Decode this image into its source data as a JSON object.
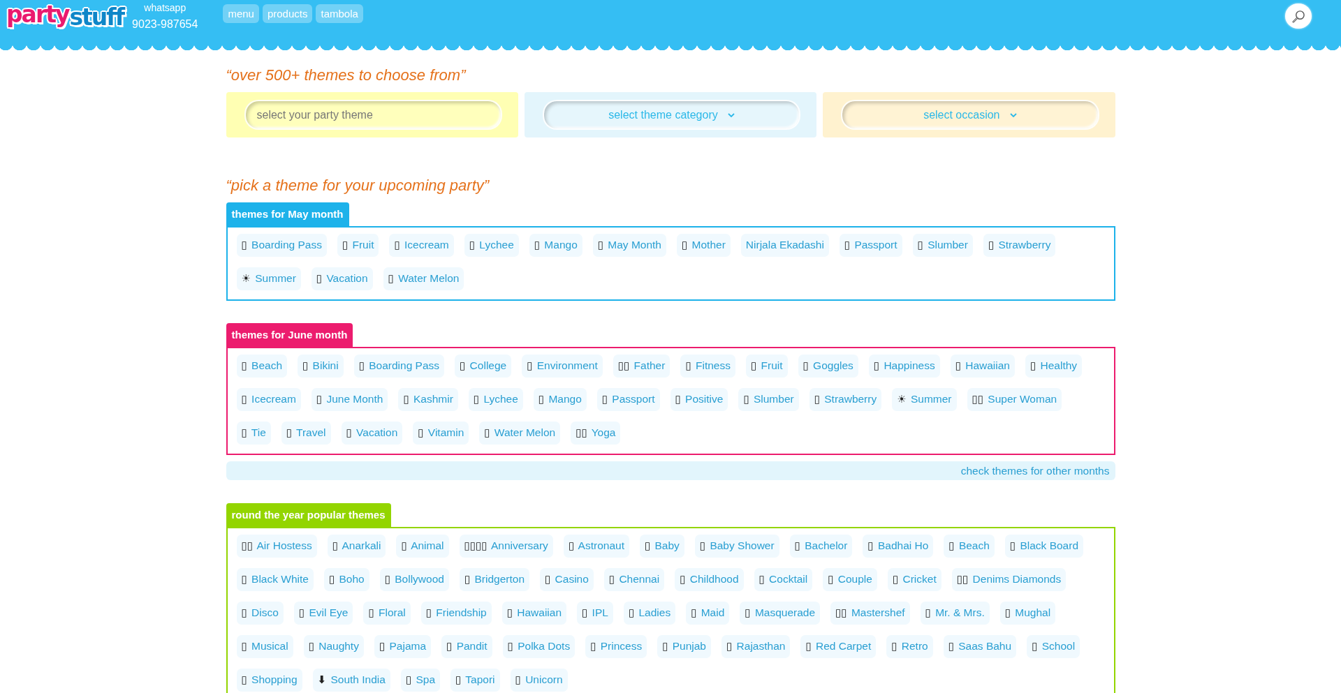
{
  "header": {
    "logo": [
      {
        "text": "party",
        "color": "#ea1a6f"
      },
      {
        "text": "stuff",
        "color": "#0e86c8"
      }
    ],
    "contact": {
      "label": "whatsapp",
      "phone": "9023-987654"
    },
    "nav": [
      "menu",
      "products",
      "tambola"
    ]
  },
  "search_heading": "“over 500+ themes to choose from”",
  "filters": [
    {
      "kind": "input",
      "placeholder": "select your party theme",
      "color": "#ffffb3"
    },
    {
      "kind": "select",
      "value": "select theme category",
      "color": "#e3f5fc"
    },
    {
      "kind": "select",
      "value": "select occasion",
      "color": "#fff2cf"
    }
  ],
  "pick_heading": "“pick a theme for your upcoming party”",
  "sections": [
    {
      "title": "themes for May month",
      "color": "#1db2ea",
      "tags": [
        {
          "icon": "▯",
          "label": "Boarding Pass"
        },
        {
          "icon": "▯",
          "label": "Fruit"
        },
        {
          "icon": "▯",
          "label": "Icecream"
        },
        {
          "icon": "▯",
          "label": "Lychee"
        },
        {
          "icon": "▯",
          "label": "Mango"
        },
        {
          "icon": "▯",
          "label": "May Month"
        },
        {
          "icon": "▯",
          "label": "Mother"
        },
        {
          "label": "Nirjala Ekadashi"
        },
        {
          "icon": "▯",
          "label": "Passport"
        },
        {
          "icon": "▯",
          "label": "Slumber"
        },
        {
          "icon": "▯",
          "label": "Strawberry"
        },
        {
          "icon": "☀",
          "label": "Summer"
        },
        {
          "icon": "▯",
          "label": "Vacation"
        },
        {
          "icon": "▯",
          "label": "Water Melon"
        }
      ]
    },
    {
      "title": "themes for June month",
      "color": "#ec1c6e",
      "footer_link": "check themes for other months",
      "tags": [
        {
          "icon": "▯",
          "label": "Beach"
        },
        {
          "icon": "▯",
          "label": "Bikini"
        },
        {
          "icon": "▯",
          "label": "Boarding Pass"
        },
        {
          "icon": "▯",
          "label": "College"
        },
        {
          "icon": "▯",
          "label": "Environment"
        },
        {
          "icon": "▯▯",
          "label": "Father"
        },
        {
          "icon": "▯",
          "label": "Fitness"
        },
        {
          "icon": "▯",
          "label": "Fruit"
        },
        {
          "icon": "▯",
          "label": "Goggles"
        },
        {
          "icon": "▯",
          "label": "Happiness"
        },
        {
          "icon": "▯",
          "label": "Hawaiian"
        },
        {
          "icon": "▯",
          "label": "Healthy"
        },
        {
          "icon": "▯",
          "label": "Icecream"
        },
        {
          "icon": "▯",
          "label": "June Month"
        },
        {
          "icon": "▯",
          "label": "Kashmir"
        },
        {
          "icon": "▯",
          "label": "Lychee"
        },
        {
          "icon": "▯",
          "label": "Mango"
        },
        {
          "icon": "▯",
          "label": "Passport"
        },
        {
          "icon": "▯",
          "label": "Positive"
        },
        {
          "icon": "▯",
          "label": "Slumber"
        },
        {
          "icon": "▯",
          "label": "Strawberry"
        },
        {
          "icon": "☀",
          "label": "Summer"
        },
        {
          "icon": "▯▯",
          "label": "Super Woman"
        },
        {
          "icon": "▯",
          "label": "Tie"
        },
        {
          "icon": "▯",
          "label": "Travel"
        },
        {
          "icon": "▯",
          "label": "Vacation"
        },
        {
          "icon": "▯",
          "label": "Vitamin"
        },
        {
          "icon": "▯",
          "label": "Water Melon"
        },
        {
          "icon": "▯▯",
          "label": "Yoga"
        }
      ]
    },
    {
      "title": "round the year popular themes",
      "color": "#93d500",
      "tags": [
        {
          "icon": "▯▯",
          "label": "Air Hostess"
        },
        {
          "icon": "▯",
          "label": "Anarkali"
        },
        {
          "icon": "▯",
          "label": "Animal"
        },
        {
          "icon": "▯▯▯▯",
          "label": "Anniversary"
        },
        {
          "icon": "▯",
          "label": "Astronaut"
        },
        {
          "icon": "▯",
          "label": "Baby"
        },
        {
          "icon": "▯",
          "label": "Baby Shower"
        },
        {
          "icon": "▯",
          "label": "Bachelor"
        },
        {
          "icon": "▯",
          "label": "Badhai Ho"
        },
        {
          "icon": "▯",
          "label": "Beach"
        },
        {
          "icon": "▯",
          "label": "Black Board"
        },
        {
          "icon": "▯",
          "label": "Black White"
        },
        {
          "icon": "▯",
          "label": "Boho"
        },
        {
          "icon": "▯",
          "label": "Bollywood"
        },
        {
          "icon": "▯",
          "label": "Bridgerton"
        },
        {
          "icon": "▯",
          "label": "Casino"
        },
        {
          "icon": "▯",
          "label": "Chennai"
        },
        {
          "icon": "▯",
          "label": "Childhood"
        },
        {
          "icon": "▯",
          "label": "Cocktail"
        },
        {
          "icon": "▯",
          "label": "Couple"
        },
        {
          "icon": "▯",
          "label": "Cricket"
        },
        {
          "icon": "▯▯",
          "label": "Denims Diamonds"
        },
        {
          "icon": "▯",
          "label": "Disco"
        },
        {
          "icon": "▯",
          "label": "Evil Eye"
        },
        {
          "icon": "▯",
          "label": "Floral"
        },
        {
          "icon": "▯",
          "label": "Friendship"
        },
        {
          "icon": "▯",
          "label": "Hawaiian"
        },
        {
          "icon": "▯",
          "label": "IPL"
        },
        {
          "icon": "▯",
          "label": "Ladies"
        },
        {
          "icon": "▯",
          "label": "Maid"
        },
        {
          "icon": "▯",
          "label": "Masquerade"
        },
        {
          "icon": "▯▯",
          "label": "Mastershef"
        },
        {
          "icon": "▯",
          "label": "Mr. & Mrs."
        },
        {
          "icon": "▯",
          "label": "Mughal"
        },
        {
          "icon": "▯",
          "label": "Musical"
        },
        {
          "icon": "▯",
          "label": "Naughty"
        },
        {
          "icon": "▯",
          "label": "Pajama"
        },
        {
          "icon": "▯",
          "label": "Pandit"
        },
        {
          "icon": "▯",
          "label": "Polka Dots"
        },
        {
          "icon": "▯",
          "label": "Princess"
        },
        {
          "icon": "▯",
          "label": "Punjab"
        },
        {
          "icon": "▯",
          "label": "Rajasthan"
        },
        {
          "icon": "▯",
          "label": "Red Carpet"
        },
        {
          "icon": "▯",
          "label": "Retro"
        },
        {
          "icon": "▯",
          "label": "Saas Bahu"
        },
        {
          "icon": "▯",
          "label": "School"
        },
        {
          "icon": "▯",
          "label": "Shopping"
        },
        {
          "icon": "⬇",
          "label": "South India"
        },
        {
          "icon": "▯",
          "label": "Spa"
        },
        {
          "icon": "▯",
          "label": "Tapori"
        },
        {
          "icon": "▯",
          "label": "Unicorn"
        }
      ]
    }
  ]
}
